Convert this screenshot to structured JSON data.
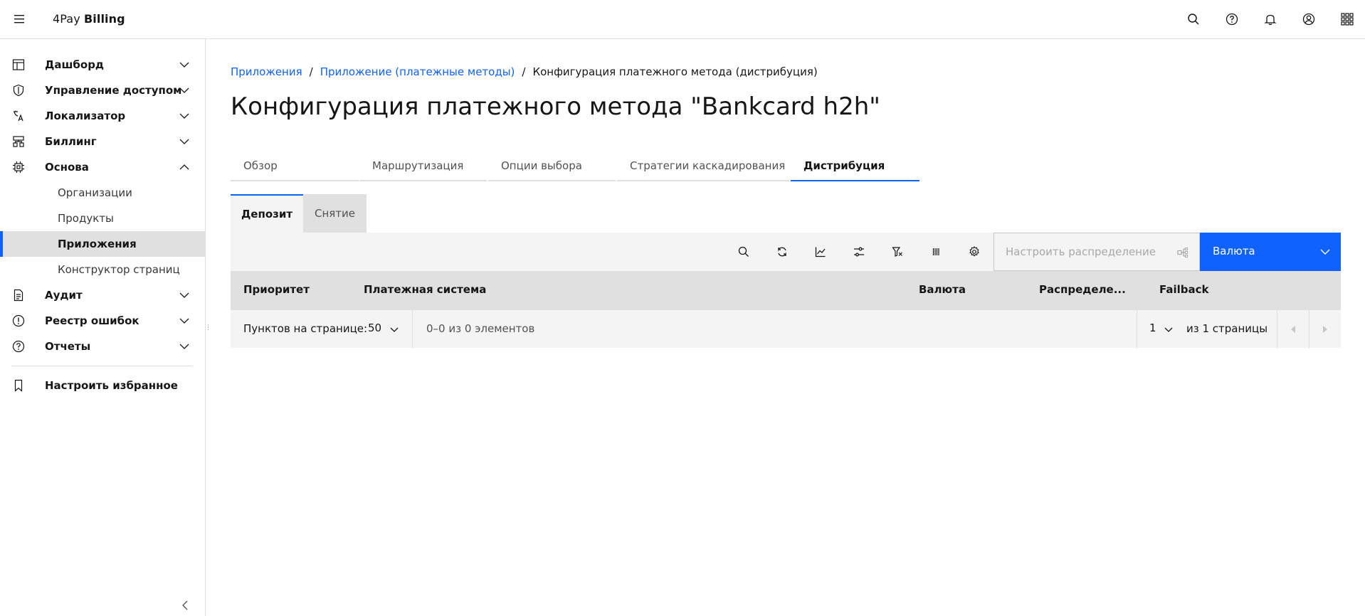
{
  "header": {
    "brand_prefix": "4Pay",
    "brand_name": "Billing",
    "icons": [
      "menu-icon",
      "search-icon",
      "help-icon",
      "notification-icon",
      "user-icon",
      "app-switcher-icon"
    ]
  },
  "sidebar": {
    "items": [
      {
        "label": "Дашборд",
        "icon": "dashboard-icon",
        "expanded": false
      },
      {
        "label": "Управление доступом",
        "icon": "shield-icon",
        "expanded": false
      },
      {
        "label": "Локализатор",
        "icon": "translate-icon",
        "expanded": false
      },
      {
        "label": "Биллинг",
        "icon": "billing-icon",
        "expanded": false
      },
      {
        "label": "Основа",
        "icon": "chip-icon",
        "expanded": true
      },
      {
        "label": "Аудит",
        "icon": "document-icon",
        "expanded": false
      },
      {
        "label": "Реестр ошибок",
        "icon": "warning-icon",
        "expanded": false
      },
      {
        "label": "Отчеты",
        "icon": "question-icon",
        "expanded": false
      }
    ],
    "subitems": [
      {
        "label": "Организации",
        "active": false
      },
      {
        "label": "Продукты",
        "active": false
      },
      {
        "label": "Приложения",
        "active": true
      },
      {
        "label": "Конструктор страниц",
        "active": false
      }
    ],
    "favorites_label": "Настроить избранное"
  },
  "breadcrumb": {
    "items": [
      "Приложения",
      "Приложение (платежные методы)"
    ],
    "separator": "/",
    "current": "Конфигурация платежного метода (дистрибуция)"
  },
  "page_title": "Конфигурация платежного метода \"Bankcard h2h\"",
  "tabs": [
    {
      "label": "Обзор",
      "active": false
    },
    {
      "label": "Маршрутизация",
      "active": false
    },
    {
      "label": "Опции выбора",
      "active": false
    },
    {
      "label": "Стратегии каскадирования",
      "active": false
    },
    {
      "label": "Дистрибуция",
      "active": true
    }
  ],
  "content_tabs": [
    {
      "label": "Депозит",
      "active": true
    },
    {
      "label": "Снятие",
      "active": false
    }
  ],
  "toolbar": {
    "icons": [
      "search-icon",
      "refresh-icon",
      "chart-icon",
      "filter-settings-icon",
      "clear-filter-icon",
      "columns-icon",
      "settings-icon"
    ],
    "distribution_placeholder": "Настроить распределение",
    "currency_label": "Валюта"
  },
  "table": {
    "columns": [
      "Приоритет",
      "Платежная система",
      "Валюта",
      "Распределе...",
      "Failback"
    ],
    "rows": []
  },
  "pagination": {
    "items_per_page_label": "Пунктов на странице:",
    "page_size": "50",
    "range_text": "0–0 из 0 элементов",
    "current_page": "1",
    "of_pages_text": "из 1 страницы"
  },
  "colors": {
    "accent": "#0f62fe",
    "surface": "#f4f4f4",
    "border": "#e0e0e0"
  }
}
